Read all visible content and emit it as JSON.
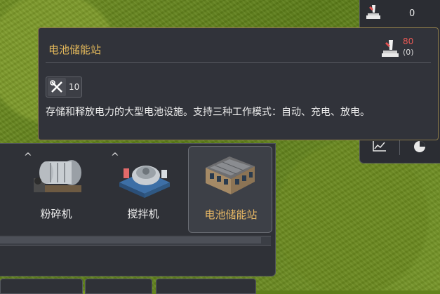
{
  "resource_panel": {
    "power_value": "0",
    "power_icon": "power-plant-icon",
    "graph_icon": "graph-icon",
    "pie_icon": "pie-chart-icon"
  },
  "tooltip": {
    "title": "电池储能站",
    "cost_value": "80",
    "cost_sub": "(0)",
    "cost_icon": "power-plant-icon",
    "maintenance_icon": "wrench-screwdriver-icon",
    "maintenance_value": "10",
    "description": "存储和释放电力的大型电池设施。支持三种工作模式：自动、充电、放电。",
    "colors": {
      "title": "#e2b75a",
      "cost": "#ec5a55",
      "border": "#8a7a4a"
    }
  },
  "build_bar": {
    "items": [
      {
        "label": "粉碎机",
        "upgrade": "^",
        "icon": "ball-mill-icon"
      },
      {
        "label": "搅拌机",
        "upgrade": "^",
        "icon": "mixer-icon"
      },
      {
        "label": "电池储能站",
        "upgrade": "",
        "icon": "battery-station-icon",
        "selected": true
      }
    ]
  }
}
